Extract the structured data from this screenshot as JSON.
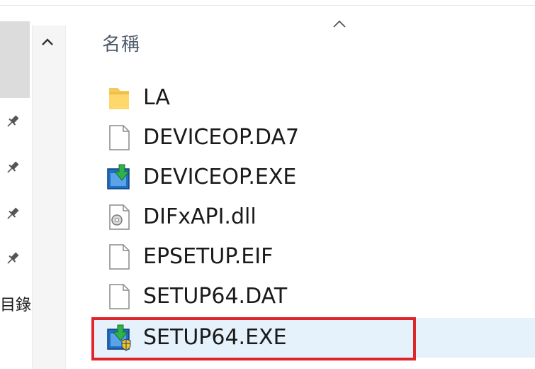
{
  "column_header": "名稱",
  "nav": {
    "partial_label": "目錄"
  },
  "files": [
    {
      "name": "LA",
      "icon": "folder-icon"
    },
    {
      "name": "DEVICEOP.DA7",
      "icon": "file-icon"
    },
    {
      "name": "DEVICEOP.EXE",
      "icon": "installer-icon"
    },
    {
      "name": "DIFxAPI.dll",
      "icon": "dll-icon"
    },
    {
      "name": "EPSETUP.EIF",
      "icon": "file-icon"
    },
    {
      "name": "SETUP64.DAT",
      "icon": "file-icon"
    },
    {
      "name": "SETUP64.EXE",
      "icon": "setup-shield-icon"
    }
  ],
  "selected_file": "SETUP64.EXE",
  "colors": {
    "highlight": "#e0242c",
    "selection": "#e5f1fb",
    "header_text": "#4d5a6a"
  }
}
